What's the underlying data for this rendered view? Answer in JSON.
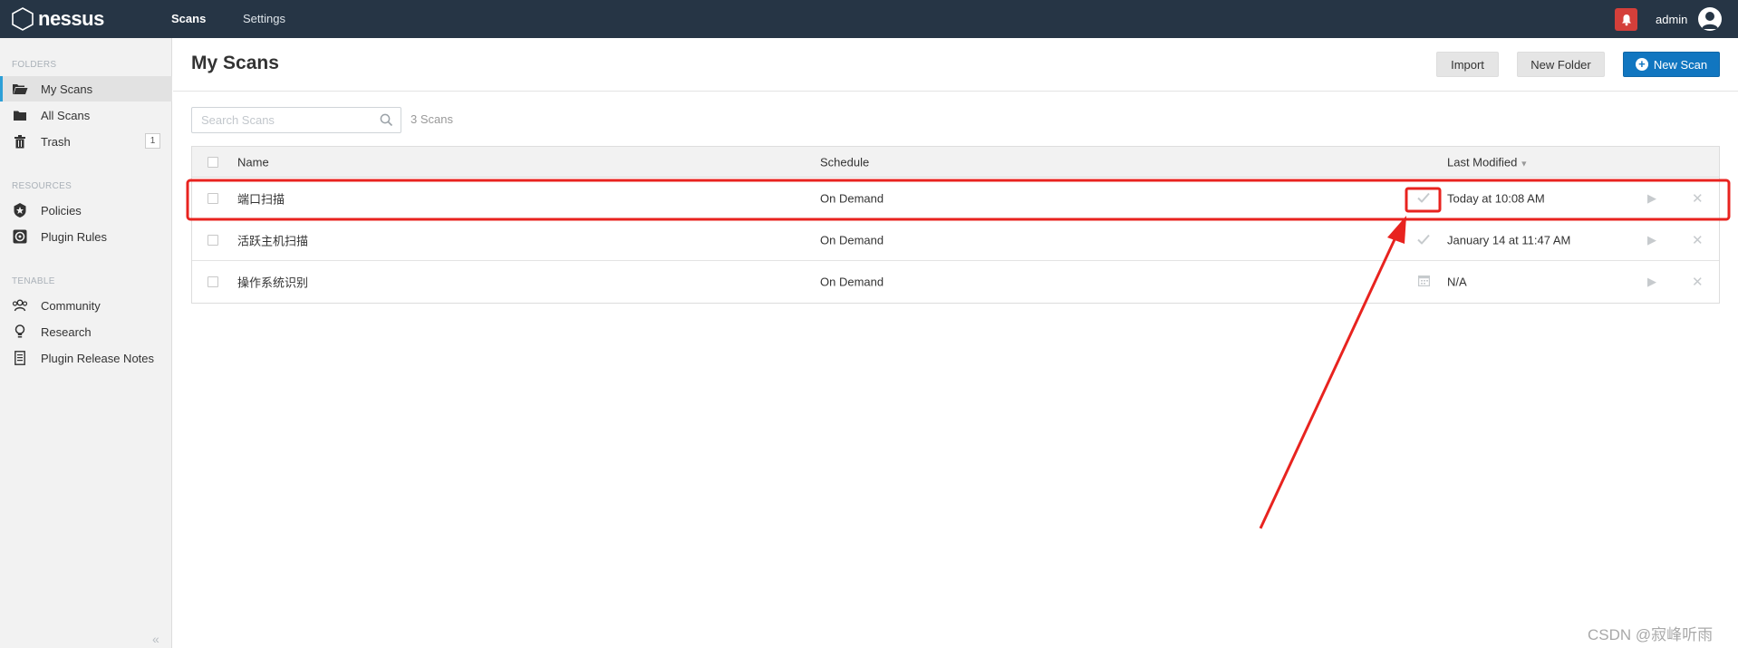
{
  "app": {
    "logo_text": "nessus"
  },
  "topnav": {
    "tabs": [
      {
        "label": "Scans"
      },
      {
        "label": "Settings"
      }
    ],
    "user": "admin"
  },
  "sidebar": {
    "sections": [
      "FOLDERS",
      "RESOURCES",
      "TENABLE"
    ],
    "folders": [
      {
        "label": "My Scans",
        "icon": "folder-open-icon"
      },
      {
        "label": "All Scans",
        "icon": "folder-icon"
      },
      {
        "label": "Trash",
        "icon": "trash-icon",
        "count": "1"
      }
    ],
    "resources": [
      {
        "label": "Policies",
        "icon": "shield-icon"
      },
      {
        "label": "Plugin Rules",
        "icon": "plugin-rules-icon"
      }
    ],
    "tenable": [
      {
        "label": "Community",
        "icon": "community-icon"
      },
      {
        "label": "Research",
        "icon": "lightbulb-icon"
      },
      {
        "label": "Plugin Release Notes",
        "icon": "notes-icon"
      }
    ],
    "collapse_glyph": "«"
  },
  "page": {
    "title": "My Scans"
  },
  "buttons": {
    "import": "Import",
    "new_folder": "New Folder",
    "new_scan": "New Scan"
  },
  "search": {
    "placeholder": "Search Scans",
    "count_label": "3 Scans"
  },
  "table": {
    "headers": {
      "name": "Name",
      "schedule": "Schedule",
      "last_modified": "Last Modified"
    },
    "rows": [
      {
        "name": "端口扫描",
        "schedule": "On Demand",
        "status_icon": "check-icon",
        "last_modified": "Today at 10:08 AM"
      },
      {
        "name": "活跃主机扫描",
        "schedule": "On Demand",
        "status_icon": "check-icon",
        "last_modified": "January 14 at 11:47 AM"
      },
      {
        "name": "操作系统识别",
        "schedule": "On Demand",
        "status_icon": "calendar-icon",
        "last_modified": "N/A"
      }
    ]
  },
  "colors": {
    "topbar": "#263545",
    "accent": "#1176c0",
    "alert": "#d43f3a",
    "annotation": "#e8231f"
  },
  "watermark": "CSDN @寂峰听雨"
}
